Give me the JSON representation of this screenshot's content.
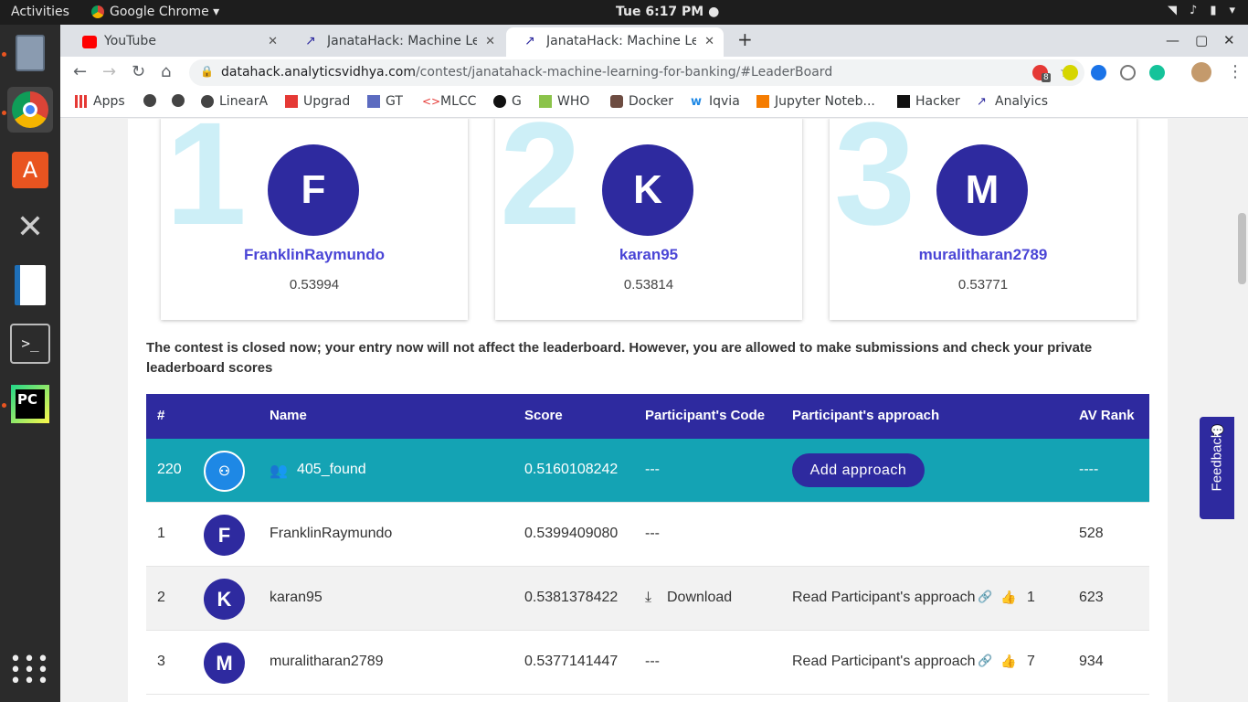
{
  "topbar": {
    "activities": "Activities",
    "app": "Google Chrome ▾",
    "clock": "Tue  6:17 PM ●"
  },
  "tabs": [
    {
      "label": "YouTube"
    },
    {
      "label": "JanataHack: Machine Lea"
    },
    {
      "label": "JanataHack: Machine Lea"
    }
  ],
  "omnibox": {
    "host": "datahack.analyticsvidhya.com",
    "path": "/contest/janatahack-machine-learning-for-banking/#LeaderBoard"
  },
  "extensions": {
    "badge": "8"
  },
  "bookmarks": [
    {
      "label": "Apps"
    },
    {
      "label": ""
    },
    {
      "label": ""
    },
    {
      "label": "LinearA"
    },
    {
      "label": "Upgrad"
    },
    {
      "label": "GT"
    },
    {
      "label": "MLCC"
    },
    {
      "label": "G"
    },
    {
      "label": "WHO"
    },
    {
      "label": "Docker"
    },
    {
      "label": "Iqvia"
    },
    {
      "label": "Jupyter Noteb..."
    },
    {
      "label": "Hacker"
    },
    {
      "label": "Analyics"
    }
  ],
  "podium": [
    {
      "rank": "1",
      "initial": "F",
      "name": "FranklinRaymundo",
      "score": "0.53994"
    },
    {
      "rank": "2",
      "initial": "K",
      "name": "karan95",
      "score": "0.53814"
    },
    {
      "rank": "3",
      "initial": "M",
      "name": "muralitharan2789",
      "score": "0.53771"
    }
  ],
  "notice": "The contest is closed now; your entry now will not affect the leaderboard. However, you are allowed to make submissions and check your private leaderboard scores",
  "table": {
    "headers": {
      "rank": "#",
      "name": "Name",
      "score": "Score",
      "code": "Participant's Code",
      "approach": "Participant's approach",
      "av_rank": "AV Rank"
    },
    "mine": {
      "rank": "220",
      "name": "405_found",
      "score": "0.5160108242",
      "code": "---",
      "approach_button": "Add approach",
      "av_rank": "----"
    },
    "rows": [
      {
        "rank": "1",
        "initial": "F",
        "name": "FranklinRaymundo",
        "score": "0.5399409080",
        "code": "---",
        "approach": "",
        "likes": "",
        "av_rank": "528"
      },
      {
        "rank": "2",
        "initial": "K",
        "name": "karan95",
        "score": "0.5381378422",
        "code": "Download",
        "approach": "Read Participant's approach",
        "likes": "1",
        "av_rank": "623"
      },
      {
        "rank": "3",
        "initial": "M",
        "name": "muralitharan2789",
        "score": "0.5377141447",
        "code": "---",
        "approach": "Read Participant's approach",
        "likes": "7",
        "av_rank": "934"
      }
    ]
  },
  "feedback": "Feedback",
  "colors": {
    "brand": "#2e2a9f",
    "highlight_row": "#14a3b4",
    "name_link": "#4a45d6",
    "rank_watermark": "#cdeff7"
  }
}
